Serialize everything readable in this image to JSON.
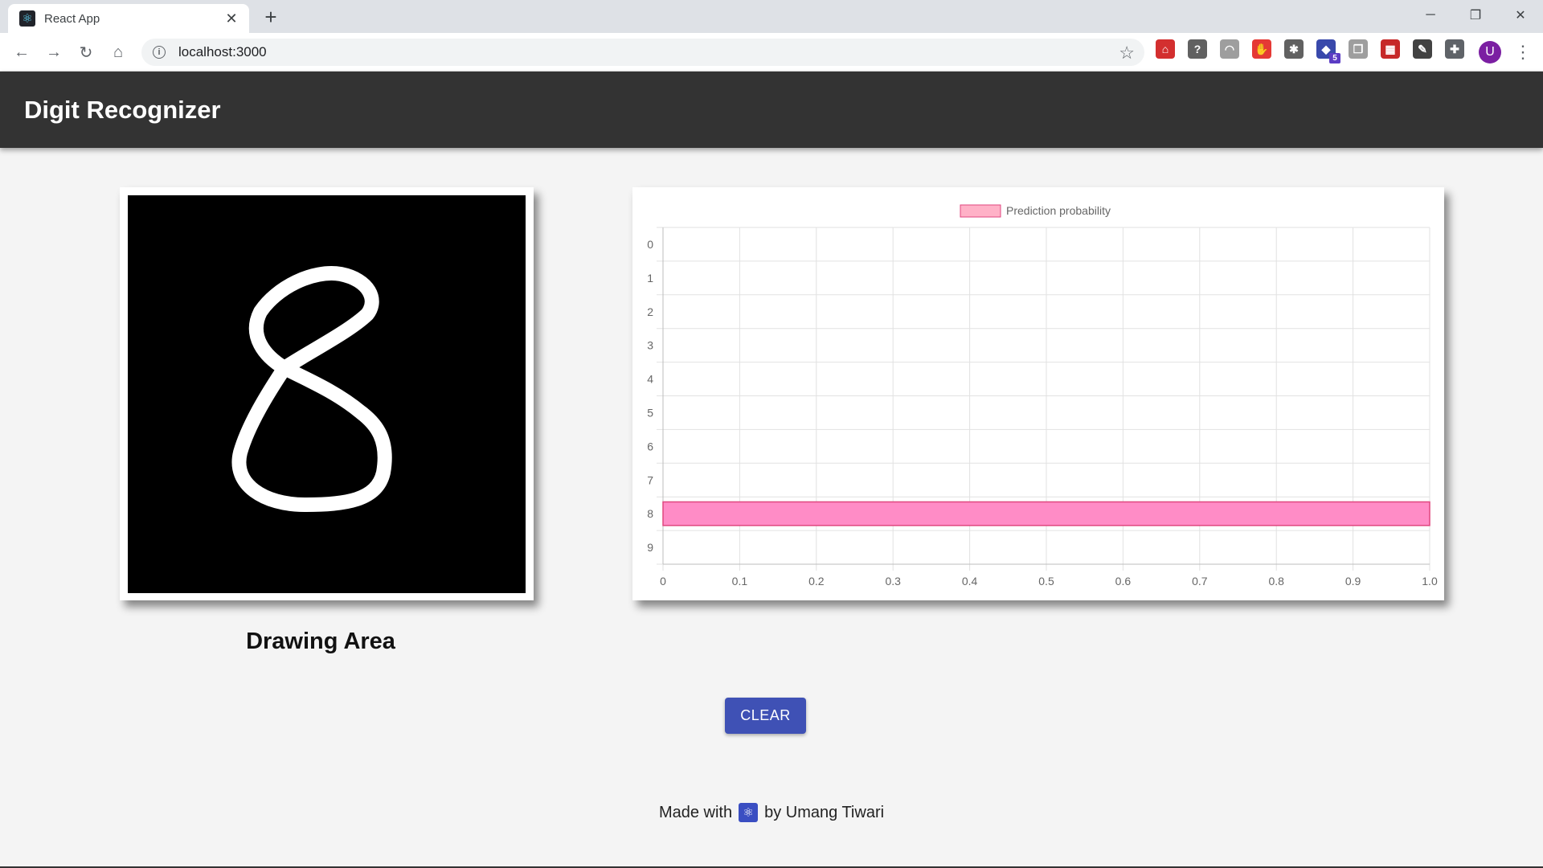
{
  "browser": {
    "tab_title": "React App",
    "url": "localhost:3000",
    "favicon": "react-atom-icon",
    "extensions": [
      {
        "name": "pdf-icon",
        "color": "#d32f2f",
        "glyph": "⌂"
      },
      {
        "name": "help-extension-icon",
        "color": "#616161",
        "glyph": "?"
      },
      {
        "name": "headphones-icon",
        "color": "#9e9e9e",
        "glyph": "◠"
      },
      {
        "name": "adblock-icon",
        "color": "#e53935",
        "glyph": "✋"
      },
      {
        "name": "bug-icon",
        "color": "#616161",
        "glyph": "✱"
      },
      {
        "name": "graduation-cap-icon",
        "color": "#3949ab",
        "glyph": "◆",
        "badge": "5"
      },
      {
        "name": "copy-icon",
        "color": "#9e9e9e",
        "glyph": "❐"
      },
      {
        "name": "image-extension-icon",
        "color": "#c62828",
        "glyph": "▦"
      },
      {
        "name": "eyedropper-icon",
        "color": "#424242",
        "glyph": "✎"
      },
      {
        "name": "puzzle-icon",
        "color": "#5f6368",
        "glyph": "✚"
      }
    ],
    "avatar_letter": "U"
  },
  "app": {
    "title": "Digit Recognizer",
    "drawing_label": "Drawing Area",
    "clear_label": "CLEAR",
    "footer_prefix": "Made with",
    "footer_suffix": "by Umang Tiwari"
  },
  "colors": {
    "appbar": "#333333",
    "bar_fill": "#ff8cc6",
    "bar_stroke": "#e0467f",
    "legend_fill": "#ffb1c7",
    "button": "#3f51b5"
  },
  "chart_data": {
    "type": "bar",
    "orientation": "horizontal",
    "categories": [
      "0",
      "1",
      "2",
      "3",
      "4",
      "5",
      "6",
      "7",
      "8",
      "9"
    ],
    "series": [
      {
        "name": "Prediction probability",
        "values": [
          0,
          0,
          0,
          0,
          0,
          0,
          0,
          0,
          1.0,
          0
        ]
      }
    ],
    "xlim": [
      0,
      1.0
    ],
    "xticks": [
      "0",
      "0.1",
      "0.2",
      "0.3",
      "0.4",
      "0.5",
      "0.6",
      "0.7",
      "0.8",
      "0.9",
      "1.0"
    ],
    "grid": true,
    "legend_position": "top-center"
  }
}
